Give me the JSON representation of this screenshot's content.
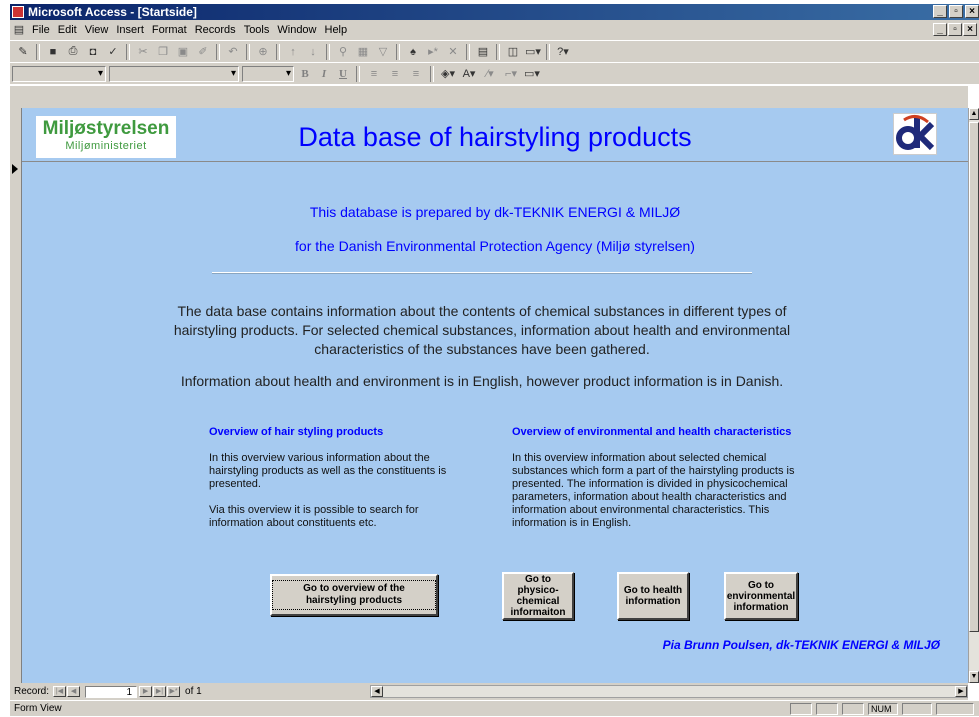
{
  "window": {
    "title": "Microsoft Access - [Startside]"
  },
  "menubar": {
    "items": [
      "File",
      "Edit",
      "View",
      "Insert",
      "Format",
      "Records",
      "Tools",
      "Window",
      "Help"
    ]
  },
  "header": {
    "logo_main": "Miljøstyrelsen",
    "logo_sub": "Miljøministeriet",
    "title": "Data base of hairstyling products",
    "logo_dk": "dk"
  },
  "intro": {
    "line1": "This database is prepared by dk-TEKNIK ENERGI & MILJØ",
    "line2": "for the Danish Environmental Protection Agency (Miljø styrelsen)"
  },
  "description": "The data base contains information about the contents of chemical substances in different types of hairstyling products. For selected chemical substances, information about health and environmental characteristics of the substances have been gathered.",
  "language_note": "Information about health and environment is in English, however product information is in Danish.",
  "left_section": {
    "heading": "Overview of hair styling products",
    "para1": "In this overview various information about the hairstyling products as well as the constituents is presented.",
    "para2": "Via this overview it is possible to search for information about constituents etc."
  },
  "right_section": {
    "heading": "Overview of environmental and health characteristics",
    "para": "In this overview information about selected chemical substances which form a part of the hairstyling products is presented. The information is divided in physicochemical parameters, information about health characteristics and information about environmental characteristics. This information is in English."
  },
  "buttons": {
    "products": "Go to overview of the hairstyling products",
    "physico": "Go to physico-chemical informaiton",
    "health": "Go to health information",
    "environmental": "Go to environmental information"
  },
  "credit": "Pia Brunn Poulsen, dk-TEKNIK ENERGI & MILJØ",
  "navigation": {
    "label": "Record:",
    "current": "1",
    "of_text": "of 1"
  },
  "status": {
    "mode": "Form View",
    "num": "NUM"
  },
  "colors": {
    "form_background": "#a6caf0",
    "accent_text": "#0000ff",
    "logo_green": "#3f9a3f"
  }
}
